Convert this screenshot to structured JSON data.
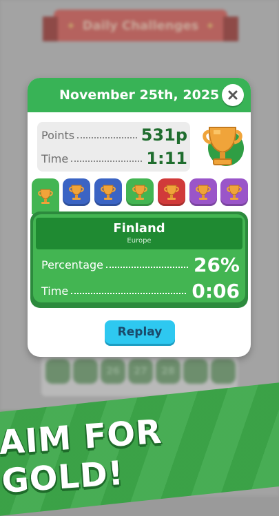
{
  "background": {
    "banner_title": "Daily Challenges",
    "days": [
      "",
      "",
      "26",
      "27",
      "28",
      "",
      ""
    ]
  },
  "modal": {
    "title": "November 25th, 2025",
    "summary": {
      "points_label": "Points",
      "points_value": "531p",
      "time_label": "Time",
      "time_value": "1:11"
    },
    "tabs": [
      {
        "color": "#43b552",
        "icon": "trophy-icon"
      },
      {
        "color": "#3b64c4",
        "icon": "trophy-icon"
      },
      {
        "color": "#3b64c4",
        "icon": "trophy-icon"
      },
      {
        "color": "#43b552",
        "icon": "trophy-icon"
      },
      {
        "color": "#d13a3a",
        "icon": "trophy-icon"
      },
      {
        "color": "#9a55c9",
        "icon": "trophy-icon"
      },
      {
        "color": "#9a55c9",
        "icon": "trophy-icon"
      }
    ],
    "detail": {
      "country": "Finland",
      "region": "Europe",
      "percentage_label": "Percentage",
      "percentage_value": "26%",
      "time_label": "Time",
      "time_value": "0:06"
    },
    "replay_label": "Replay"
  },
  "slogan": "AIM FOR GOLD!",
  "colors": {
    "accent_green": "#38b356",
    "dark_green": "#1f6d2e",
    "replay_blue": "#2ec8f0",
    "trophy_gold": "#f0a43a"
  }
}
